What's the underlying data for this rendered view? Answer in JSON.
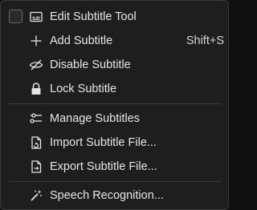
{
  "menu": {
    "items": [
      {
        "label": "Edit Subtitle Tool",
        "icon": "subtitle-tool-icon",
        "checked": false
      },
      {
        "label": "Add Subtitle",
        "icon": "plus-icon",
        "shortcut": "Shift+S"
      },
      {
        "label": "Disable Subtitle",
        "icon": "eye-slash-icon"
      },
      {
        "label": "Lock Subtitle",
        "icon": "lock-icon"
      },
      {
        "label": "Manage Subtitles",
        "icon": "sliders-icon"
      },
      {
        "label": "Import Subtitle File...",
        "icon": "import-file-icon"
      },
      {
        "label": "Export Subtitle File...",
        "icon": "export-file-icon"
      },
      {
        "label": "Speech Recognition...",
        "icon": "magic-wand-icon"
      }
    ]
  }
}
